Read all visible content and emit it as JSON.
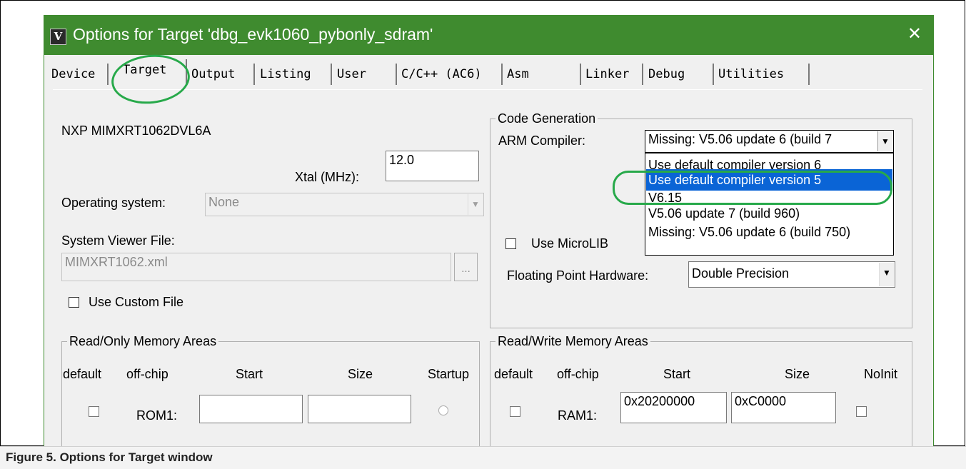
{
  "dialog": {
    "title": "Options for Target 'dbg_evk1060_pybonly_sdram'",
    "app_icon_glyph": "V",
    "close_glyph": "✕"
  },
  "tabs": [
    "Device",
    "Target",
    "Output",
    "Listing",
    "User",
    "C/C++ (AC6)",
    "Asm",
    "Linker",
    "Debug",
    "Utilities"
  ],
  "active_tab": "Target",
  "device": {
    "name": "NXP MIMXRT1062DVL6A",
    "xtal_label": "Xtal (MHz):",
    "xtal_value": "12.0",
    "os_label": "Operating system:",
    "os_value": "None",
    "svf_label": "System Viewer File:",
    "svf_value": "MIMXRT1062.xml",
    "browse_glyph": "...",
    "custom_file_label": "Use Custom File"
  },
  "code_generation": {
    "group_title": "Code Generation",
    "compiler_label": "ARM Compiler:",
    "compiler_value": "Missing: V5.06 update 6 (build 7",
    "compiler_options": [
      "Use default compiler version 6",
      "Use default compiler version 5",
      "V6.15",
      "V5.06 update 7 (build 960)",
      "Missing: V5.06 update 6 (build 750)"
    ],
    "selected_option_index": 1,
    "microlib_label": "Use MicroLIB",
    "fph_label": "Floating Point Hardware:",
    "fph_value": "Double Precision"
  },
  "ro_memory": {
    "group_title": "Read/Only Memory Areas",
    "headers": [
      "default",
      "off-chip",
      "Start",
      "Size",
      "Startup"
    ],
    "row_label": "ROM1:",
    "start": "",
    "size": ""
  },
  "rw_memory": {
    "group_title": "Read/Write Memory Areas",
    "headers": [
      "default",
      "off-chip",
      "Start",
      "Size",
      "NoInit"
    ],
    "row_label": "RAM1:",
    "start": "0x20200000",
    "size": "0xC0000"
  },
  "caption": "Figure 5.  Options for Target window",
  "colors": {
    "titlebar": "#3f8b2f",
    "highlight_oval": "#27a94a",
    "selection": "#0a64d6"
  }
}
